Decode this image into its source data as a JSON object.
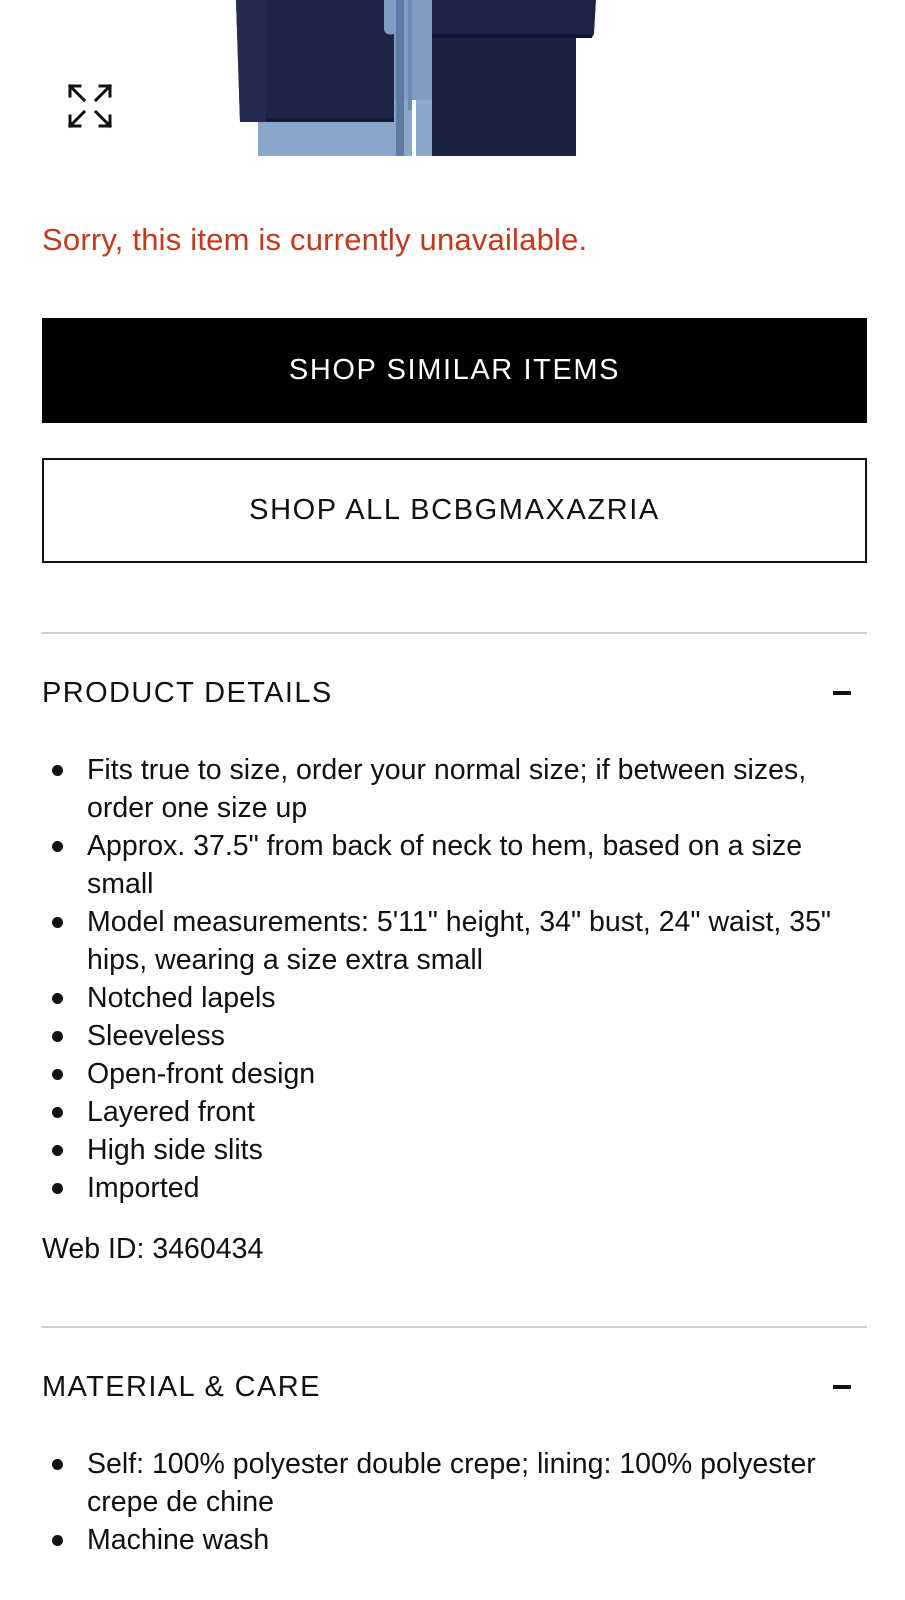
{
  "hero": {
    "expand_icon": "expand-icon"
  },
  "status": {
    "unavailable_message": "Sorry, this item is currently unavailable."
  },
  "actions": {
    "shop_similar_label": "SHOP SIMILAR ITEMS",
    "shop_all_label": "SHOP ALL BCBGMAXAZRIA"
  },
  "product_details": {
    "title": "PRODUCT DETAILS",
    "toggle_icon": "minus-icon",
    "items": [
      "Fits true to size, order your normal size; if between sizes, order one size up",
      "Approx. 37.5\" from back of neck to hem, based on a size small",
      "Model measurements: 5'11\" height, 34\" bust, 24\" waist, 35\" hips, wearing a size extra small",
      "Notched lapels",
      "Sleeveless",
      "Open-front design",
      "Layered front",
      "High side slits",
      "Imported"
    ],
    "web_id": "Web ID: 3460434"
  },
  "material_care": {
    "title": "MATERIAL & CARE",
    "toggle_icon": "minus-icon",
    "items": [
      "Self: 100% polyester double crepe; lining: 100% polyester crepe de chine",
      "Machine wash"
    ]
  },
  "colors": {
    "error_text": "#c23a1d",
    "primary_button_bg": "#000000",
    "divider": "#cfcfcf"
  }
}
